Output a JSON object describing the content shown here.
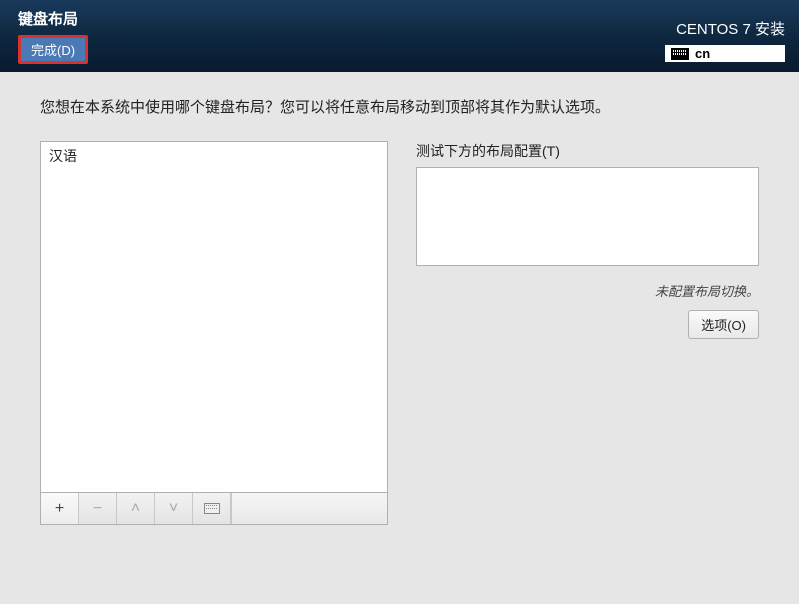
{
  "header": {
    "title": "键盘布局",
    "done_label": "完成(D)",
    "install_title": "CENTOS 7 安装",
    "lang_code": "cn"
  },
  "instruction": "您想在本系统中使用哪个键盘布局？您可以将任意布局移动到顶部将其作为默认选项。",
  "layouts": {
    "items": [
      {
        "label": "汉语"
      }
    ]
  },
  "toolbar": {
    "add": "+",
    "remove": "−",
    "up": "˄",
    "down": "˅"
  },
  "right": {
    "test_label": "测试下方的布局配置(T)",
    "switch_status": "未配置布局切换。",
    "options_label": "选项(O)"
  }
}
